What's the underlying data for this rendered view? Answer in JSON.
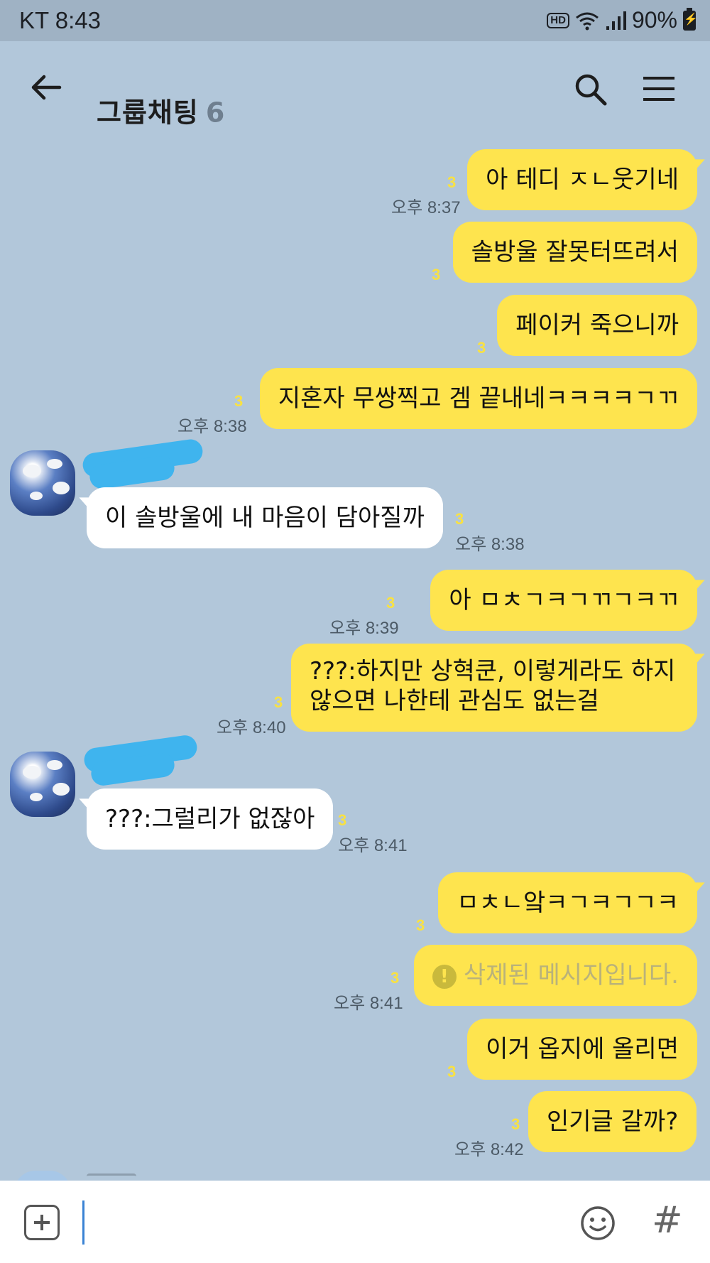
{
  "status_bar": {
    "carrier_time": "KT 8:43",
    "hd": "HD",
    "battery": "90%"
  },
  "header": {
    "title": "그룹채팅",
    "member_count": "6"
  },
  "messages": [
    {
      "text": "아 테디 ㅈㄴ웃기네",
      "unread": "3",
      "time": "오후 8:37"
    },
    {
      "text": "솔방울 잘못터뜨려서",
      "unread": "3",
      "time": ""
    },
    {
      "text": "페이커 죽으니까",
      "unread": "3",
      "time": ""
    },
    {
      "text": "지혼자 무쌍찍고 겜 끝내네ㅋㅋㅋㅋㄱㄲ",
      "unread": "3",
      "time": "오후 8:38"
    },
    {
      "text": "이 솔방울에 내 마음이 담아질까",
      "unread": "3",
      "time": "오후 8:38"
    },
    {
      "text": "아 ㅁㅊㄱㅋㄱㄲㄱㅋㄲ",
      "unread": "3",
      "time": "오후 8:39"
    },
    {
      "line1": "???:하지만 상혁쿤, 이렇게라도 하지",
      "line2": "않으면 나한테 관심도 없는걸",
      "unread": "3",
      "time": "오후 8:40"
    },
    {
      "text": "???:그럴리가 없잖아",
      "unread": "3",
      "time": "오후 8:41"
    },
    {
      "text": "ㅁㅊㄴ앜ㅋㄱㅋㄱㄱㅋ",
      "unread": "3",
      "time": ""
    },
    {
      "text": "삭제된 메시지입니다.",
      "unread": "3",
      "time": "오후 8:41"
    },
    {
      "text": "이거 옵지에 올리면",
      "unread": "3",
      "time": ""
    },
    {
      "text": "인기글 갈까?",
      "unread": "3",
      "time": "오후 8:42"
    }
  ],
  "colors": {
    "background": "#b2c7da",
    "my_bubble": "#fee44e",
    "their_bubble": "#ffffff",
    "unread": "#f8e143"
  },
  "icons": [
    "back-arrow-icon",
    "search-icon",
    "menu-icon",
    "plus-icon",
    "emoji-icon",
    "hash-icon",
    "warning-icon"
  ]
}
